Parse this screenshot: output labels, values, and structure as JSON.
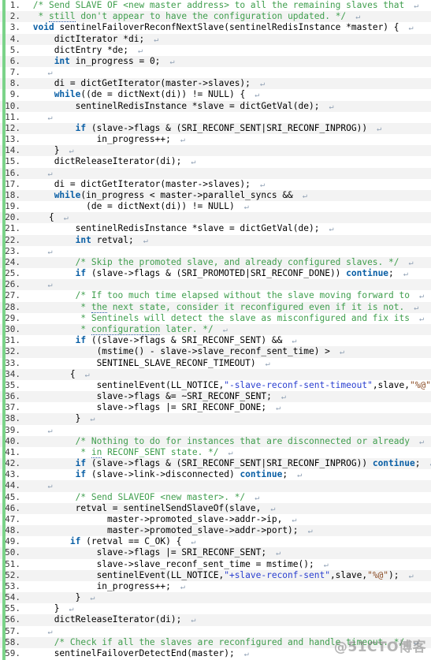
{
  "editor": {
    "language": "c",
    "total_lines": 59,
    "colors": {
      "background": "#ffffff",
      "alt_row": "#f3f3f3",
      "change_bar": "#7bd389",
      "comment": "#3f9e4d",
      "keyword": "#0a5fa5",
      "string": "#2a3fd0",
      "format_spec": "#8a4b23",
      "plain": "#000000",
      "line_number": "#3a3a3a",
      "cr_mark": "#8fa0b4"
    },
    "cr_glyph": "↵",
    "watermark": "@51CTO博客"
  },
  "lines": [
    {
      "n": "1.",
      "indent": 1,
      "tokens": [
        {
          "t": "comment",
          "v": "/* Send SLAVE OF <new master address> to all the remaining slaves that"
        }
      ],
      "cr": true
    },
    {
      "n": "2.",
      "indent": 2,
      "tokens": [
        {
          "t": "comment",
          "v": "* "
        },
        {
          "t": "comment-spell",
          "v": "still"
        },
        {
          "t": "comment",
          "v": " don't appear to have the configuration updated. */"
        }
      ],
      "cr": true
    },
    {
      "n": "3.",
      "indent": 1,
      "tokens": [
        {
          "t": "kw",
          "v": "void"
        },
        {
          "t": "plain",
          "v": " sentinelFailoverReconfNextSlave(sentinelRedisInstance *master) {"
        }
      ],
      "cr": true
    },
    {
      "n": "4.",
      "indent": 5,
      "tokens": [
        {
          "t": "plain",
          "v": "dictIterator *di;"
        }
      ],
      "cr": true
    },
    {
      "n": "5.",
      "indent": 5,
      "tokens": [
        {
          "t": "plain",
          "v": "dictEntry *de;"
        }
      ],
      "cr": true
    },
    {
      "n": "6.",
      "indent": 5,
      "tokens": [
        {
          "t": "kw",
          "v": "int"
        },
        {
          "t": "plain",
          "v": " in_progress = 0;"
        }
      ],
      "cr": true
    },
    {
      "n": "7.",
      "indent": 2,
      "tokens": [],
      "cr": true
    },
    {
      "n": "8.",
      "indent": 5,
      "tokens": [
        {
          "t": "plain",
          "v": "di = dictGetIterator(master->slaves);"
        }
      ],
      "cr": true
    },
    {
      "n": "9.",
      "indent": 5,
      "tokens": [
        {
          "t": "kw",
          "v": "while"
        },
        {
          "t": "plain",
          "v": "((de = dictNext(di)) != NULL) {"
        }
      ],
      "cr": true
    },
    {
      "n": "10.",
      "indent": 9,
      "tokens": [
        {
          "t": "plain",
          "v": "sentinelRedisInstance *slave = dictGetVal(de);"
        }
      ],
      "cr": true
    },
    {
      "n": "11.",
      "indent": 2,
      "tokens": [],
      "cr": true
    },
    {
      "n": "12.",
      "indent": 9,
      "tokens": [
        {
          "t": "kw",
          "v": "if"
        },
        {
          "t": "plain",
          "v": " (slave->flags & (SRI_RECONF_SENT|SRI_RECONF_INPROG))"
        }
      ],
      "cr": true
    },
    {
      "n": "13.",
      "indent": 13,
      "tokens": [
        {
          "t": "plain",
          "v": "in_progress++;"
        }
      ],
      "cr": true
    },
    {
      "n": "14.",
      "indent": 5,
      "tokens": [
        {
          "t": "plain",
          "v": "}"
        }
      ],
      "cr": true
    },
    {
      "n": "15.",
      "indent": 5,
      "tokens": [
        {
          "t": "plain",
          "v": "dictReleaseIterator(di);"
        }
      ],
      "cr": true
    },
    {
      "n": "16.",
      "indent": 2,
      "tokens": [],
      "cr": true
    },
    {
      "n": "17.",
      "indent": 5,
      "tokens": [
        {
          "t": "plain",
          "v": "di = dictGetIterator(master->slaves);"
        }
      ],
      "cr": true
    },
    {
      "n": "18.",
      "indent": 5,
      "tokens": [
        {
          "t": "kw",
          "v": "while"
        },
        {
          "t": "plain",
          "v": "(in_progress < master->parallel_syncs &&"
        }
      ],
      "cr": true
    },
    {
      "n": "19.",
      "indent": 11,
      "tokens": [
        {
          "t": "plain",
          "v": "(de = dictNext(di)) != NULL)"
        }
      ],
      "cr": true
    },
    {
      "n": "20.",
      "indent": 4,
      "tokens": [
        {
          "t": "plain",
          "v": "{"
        }
      ],
      "cr": true
    },
    {
      "n": "21.",
      "indent": 9,
      "tokens": [
        {
          "t": "plain",
          "v": "sentinelRedisInstance *slave = dictGetVal(de);"
        }
      ],
      "cr": true
    },
    {
      "n": "22.",
      "indent": 9,
      "tokens": [
        {
          "t": "kw",
          "v": "int"
        },
        {
          "t": "plain",
          "v": " retval;"
        }
      ],
      "cr": true
    },
    {
      "n": "23.",
      "indent": 2,
      "tokens": [],
      "cr": true
    },
    {
      "n": "24.",
      "indent": 9,
      "tokens": [
        {
          "t": "comment",
          "v": "/* Skip the promoted slave, and already configured slaves. */"
        }
      ],
      "cr": true
    },
    {
      "n": "25.",
      "indent": 9,
      "tokens": [
        {
          "t": "kw",
          "v": "if"
        },
        {
          "t": "plain",
          "v": " (slave->flags & (SRI_PROMOTED|SRI_RECONF_DONE)) "
        },
        {
          "t": "kw",
          "v": "continue"
        },
        {
          "t": "plain",
          "v": ";"
        }
      ],
      "cr": true
    },
    {
      "n": "26.",
      "indent": 2,
      "tokens": [],
      "cr": true
    },
    {
      "n": "27.",
      "indent": 9,
      "tokens": [
        {
          "t": "comment",
          "v": "/* If too much time elapsed without the slave moving forward to"
        }
      ],
      "cr": true
    },
    {
      "n": "28.",
      "indent": 10,
      "tokens": [
        {
          "t": "comment",
          "v": "* "
        },
        {
          "t": "comment-spell",
          "v": "the"
        },
        {
          "t": "comment",
          "v": " next state, consider it reconfigured even if it is not."
        }
      ],
      "cr": true
    },
    {
      "n": "29.",
      "indent": 10,
      "tokens": [
        {
          "t": "comment",
          "v": "* Sentinels will detect the slave as misconfigured and fix its"
        }
      ],
      "cr": true
    },
    {
      "n": "30.",
      "indent": 10,
      "tokens": [
        {
          "t": "comment",
          "v": "* "
        },
        {
          "t": "comment-spell",
          "v": "configuration"
        },
        {
          "t": "comment",
          "v": " later. */"
        }
      ],
      "cr": true
    },
    {
      "n": "31.",
      "indent": 9,
      "tokens": [
        {
          "t": "kw",
          "v": "if"
        },
        {
          "t": "plain",
          "v": " ((slave->flags & SRI_RECONF_SENT) &&"
        }
      ],
      "cr": true
    },
    {
      "n": "32.",
      "indent": 13,
      "tokens": [
        {
          "t": "plain",
          "v": "(mstime() - slave->slave_reconf_sent_time) >"
        }
      ],
      "cr": true
    },
    {
      "n": "33.",
      "indent": 13,
      "tokens": [
        {
          "t": "plain",
          "v": "SENTINEL_SLAVE_RECONF_TIMEOUT)"
        }
      ],
      "cr": true
    },
    {
      "n": "34.",
      "indent": 8,
      "tokens": [
        {
          "t": "plain",
          "v": "{"
        }
      ],
      "cr": true
    },
    {
      "n": "35.",
      "indent": 13,
      "tokens": [
        {
          "t": "plain",
          "v": "sentinelEvent(LL_NOTICE,"
        },
        {
          "t": "str",
          "v": "\"-slave-reconf-sent-timeout\""
        },
        {
          "t": "plain",
          "v": ",slave,"
        },
        {
          "t": "fmt",
          "v": "\"%@\""
        },
        {
          "t": "plain",
          "v": ");"
        }
      ],
      "cr": false
    },
    {
      "n": "36.",
      "indent": 13,
      "tokens": [
        {
          "t": "plain",
          "v": "slave->flags &= ~SRI_RECONF_SENT;"
        }
      ],
      "cr": true
    },
    {
      "n": "37.",
      "indent": 13,
      "tokens": [
        {
          "t": "plain",
          "v": "slave->flags |= SRI_RECONF_DONE;"
        }
      ],
      "cr": true
    },
    {
      "n": "38.",
      "indent": 9,
      "tokens": [
        {
          "t": "plain",
          "v": "}"
        }
      ],
      "cr": true
    },
    {
      "n": "39.",
      "indent": 2,
      "tokens": [],
      "cr": true
    },
    {
      "n": "40.",
      "indent": 9,
      "tokens": [
        {
          "t": "comment",
          "v": "/* Nothing to do for instances that are disconnected or already"
        }
      ],
      "cr": true
    },
    {
      "n": "41.",
      "indent": 10,
      "tokens": [
        {
          "t": "comment",
          "v": "* "
        },
        {
          "t": "comment-spell",
          "v": "in"
        },
        {
          "t": "comment",
          "v": " RECONF_SENT state. */"
        }
      ],
      "cr": true
    },
    {
      "n": "42.",
      "indent": 9,
      "tokens": [
        {
          "t": "kw",
          "v": "if"
        },
        {
          "t": "plain",
          "v": " (slave->flags & (SRI_RECONF_SENT|SRI_RECONF_INPROG)) "
        },
        {
          "t": "kw",
          "v": "continue"
        },
        {
          "t": "plain",
          "v": ";"
        }
      ],
      "cr": true
    },
    {
      "n": "43.",
      "indent": 9,
      "tokens": [
        {
          "t": "kw",
          "v": "if"
        },
        {
          "t": "plain",
          "v": " (slave->link->disconnected) "
        },
        {
          "t": "kw",
          "v": "continue"
        },
        {
          "t": "plain",
          "v": ";"
        }
      ],
      "cr": true
    },
    {
      "n": "44.",
      "indent": 2,
      "tokens": [],
      "cr": true
    },
    {
      "n": "45.",
      "indent": 9,
      "tokens": [
        {
          "t": "comment",
          "v": "/* Send SLAVEOF <new master>. */"
        }
      ],
      "cr": true
    },
    {
      "n": "46.",
      "indent": 9,
      "tokens": [
        {
          "t": "plain",
          "v": "retval = sentinelSendSlaveOf(slave,"
        }
      ],
      "cr": true
    },
    {
      "n": "47.",
      "indent": 15,
      "tokens": [
        {
          "t": "plain",
          "v": "master->promoted_slave->addr->ip,"
        }
      ],
      "cr": true
    },
    {
      "n": "48.",
      "indent": 15,
      "tokens": [
        {
          "t": "plain",
          "v": "master->promoted_slave->addr->port);"
        }
      ],
      "cr": true
    },
    {
      "n": "49.",
      "indent": 8,
      "tokens": [
        {
          "t": "kw",
          "v": "if"
        },
        {
          "t": "plain",
          "v": " (retval == C_OK) {"
        }
      ],
      "cr": true
    },
    {
      "n": "50.",
      "indent": 13,
      "tokens": [
        {
          "t": "plain",
          "v": "slave->flags |= SRI_RECONF_SENT;"
        }
      ],
      "cr": true
    },
    {
      "n": "51.",
      "indent": 13,
      "tokens": [
        {
          "t": "plain",
          "v": "slave->slave_reconf_sent_time = mstime();"
        }
      ],
      "cr": true
    },
    {
      "n": "52.",
      "indent": 13,
      "tokens": [
        {
          "t": "plain",
          "v": "sentinelEvent(LL_NOTICE,"
        },
        {
          "t": "str",
          "v": "\"+slave-reconf-sent\""
        },
        {
          "t": "plain",
          "v": ",slave,"
        },
        {
          "t": "fmt",
          "v": "\"%@\""
        },
        {
          "t": "plain",
          "v": ");"
        }
      ],
      "cr": true
    },
    {
      "n": "53.",
      "indent": 13,
      "tokens": [
        {
          "t": "plain",
          "v": "in_progress++;"
        }
      ],
      "cr": true
    },
    {
      "n": "54.",
      "indent": 9,
      "tokens": [
        {
          "t": "plain",
          "v": "}"
        }
      ],
      "cr": true
    },
    {
      "n": "55.",
      "indent": 5,
      "tokens": [
        {
          "t": "plain",
          "v": "}"
        }
      ],
      "cr": true
    },
    {
      "n": "56.",
      "indent": 5,
      "tokens": [
        {
          "t": "plain",
          "v": "dictReleaseIterator(di);"
        }
      ],
      "cr": true
    },
    {
      "n": "57.",
      "indent": 2,
      "tokens": [],
      "cr": true
    },
    {
      "n": "58.",
      "indent": 5,
      "tokens": [
        {
          "t": "comment",
          "v": "/* Check if all the slaves are reconfigured and handle timeout. */"
        }
      ],
      "cr": true
    },
    {
      "n": "59.",
      "indent": 5,
      "tokens": [
        {
          "t": "plain",
          "v": "sentinelFailoverDetectEnd(master);"
        }
      ],
      "cr": true
    }
  ]
}
